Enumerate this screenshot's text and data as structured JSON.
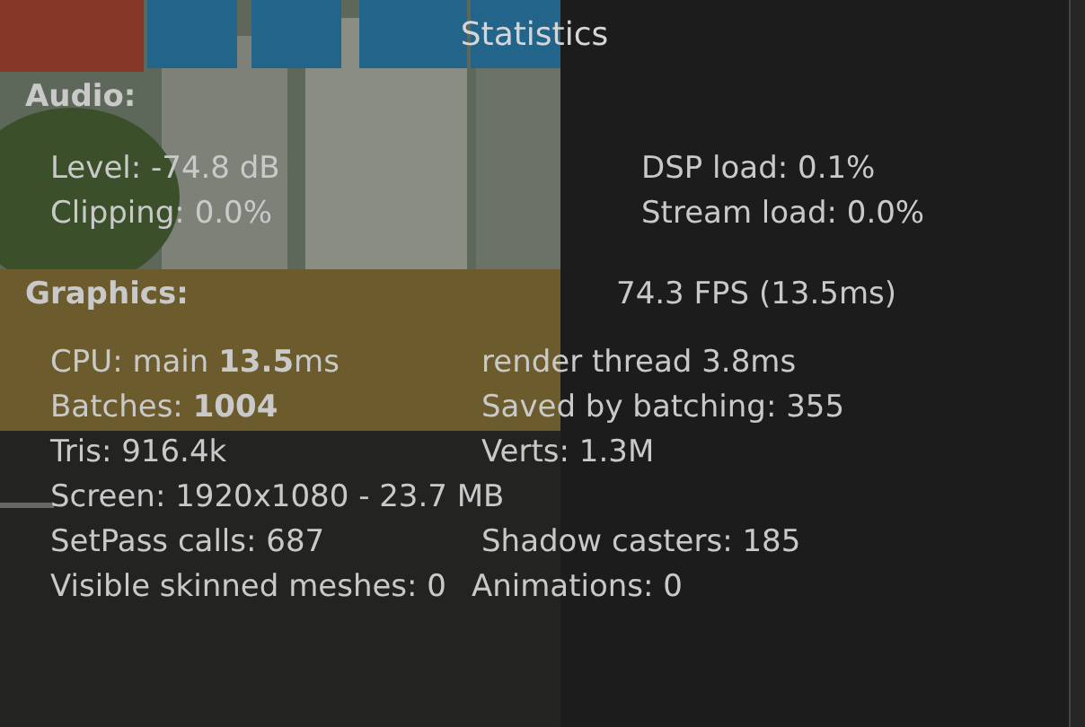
{
  "window": {
    "title": "Statistics"
  },
  "audio": {
    "heading": "Audio:",
    "level": "Level: -74.8 dB",
    "clipping": "Clipping: 0.0%",
    "dsp_load": "DSP load: 0.1%",
    "stream_load": "Stream load: 0.0%"
  },
  "graphics": {
    "heading": "Graphics:",
    "fps": "74.3 FPS (13.5ms)",
    "rows": [
      {
        "kind": "columns",
        "left": "CPU: main **13.5**ms",
        "right": "render thread 3.8ms"
      },
      {
        "kind": "columns",
        "left": "Batches: **1004**",
        "right": "Saved by batching: 355"
      },
      {
        "kind": "columns",
        "left": "Tris: 916.4k",
        "right": "Verts: 1.3M"
      },
      {
        "kind": "single",
        "left": "Screen: 1920x1080 - 23.7 MB"
      },
      {
        "kind": "columns",
        "left": "SetPass calls: 687",
        "right": "Shadow casters: 185"
      },
      {
        "kind": "inline",
        "left": "Visible skinned meshes: 0",
        "right": "Animations: 0"
      }
    ]
  }
}
